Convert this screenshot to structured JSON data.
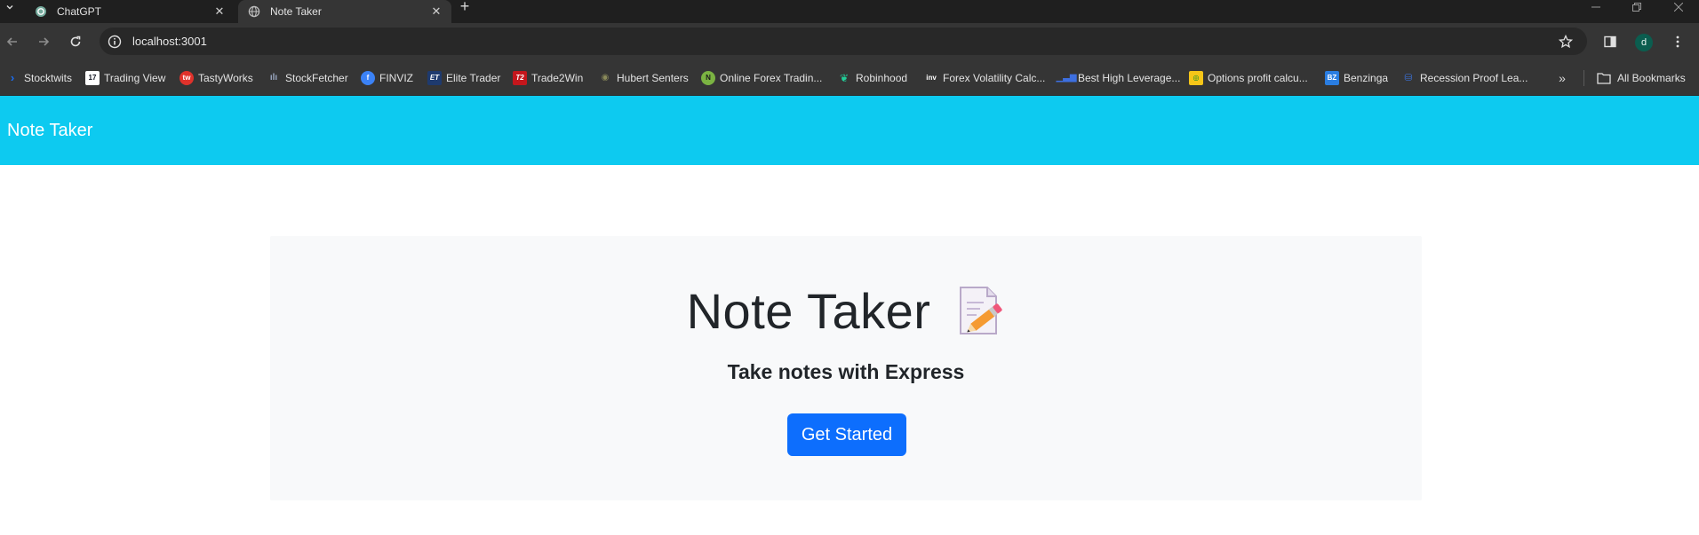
{
  "browser": {
    "tabs": [
      {
        "title": "ChatGPT",
        "favicon": "chatgpt-icon",
        "active": false
      },
      {
        "title": "Note Taker",
        "favicon": "globe-icon",
        "active": true
      }
    ],
    "new_tab": "+",
    "url": "localhost:3001",
    "profile_initial": "d",
    "bookmarks": [
      {
        "label": "Stocktwits",
        "icon": "stocktwits-icon",
        "color": "#1b6ef3"
      },
      {
        "label": "Trading View",
        "icon": "tradingview-icon",
        "color": "#131722"
      },
      {
        "label": "TastyWorks",
        "icon": "tastyworks-icon",
        "color": "#e0322b"
      },
      {
        "label": "StockFetcher",
        "icon": "stockfetcher-icon",
        "color": "#9aa7c2"
      },
      {
        "label": "FINVIZ",
        "icon": "finviz-icon",
        "color": "#3b82f6"
      },
      {
        "label": "Elite Trader",
        "icon": "elitetrader-icon",
        "color": "#1e3a6e"
      },
      {
        "label": "Trade2Win",
        "icon": "trade2win-icon",
        "color": "#c4161c"
      },
      {
        "label": "Hubert Senters",
        "icon": "hubertsenters-icon",
        "color": "#6b6b3a"
      },
      {
        "label": "Online Forex Tradin...",
        "icon": "forex-icon",
        "color": "#7bb342"
      },
      {
        "label": "Robinhood",
        "icon": "robinhood-icon",
        "color": "#21ce99"
      },
      {
        "label": "Forex Volatility Calc...",
        "icon": "investing-icon",
        "color": "#2b2b2b"
      },
      {
        "label": "Best High Leverage...",
        "icon": "leverage-icon",
        "color": "#3d6fe0"
      },
      {
        "label": "Options profit calcu...",
        "icon": "options-icon",
        "color": "#f5c518"
      },
      {
        "label": "Benzinga",
        "icon": "benzinga-icon",
        "color": "#2a7de1"
      },
      {
        "label": "Recession Proof Lea...",
        "icon": "recession-icon",
        "color": "#3b6fd1"
      }
    ],
    "all_bookmarks": "All Bookmarks"
  },
  "page": {
    "navbar_color": "#0dcaf0",
    "brand": "Note Taker",
    "hero_title": "Note Taker",
    "hero_icon": "memo-icon",
    "lead": "Take notes with Express",
    "cta": "Get Started",
    "cta_color": "#0d6efd"
  }
}
